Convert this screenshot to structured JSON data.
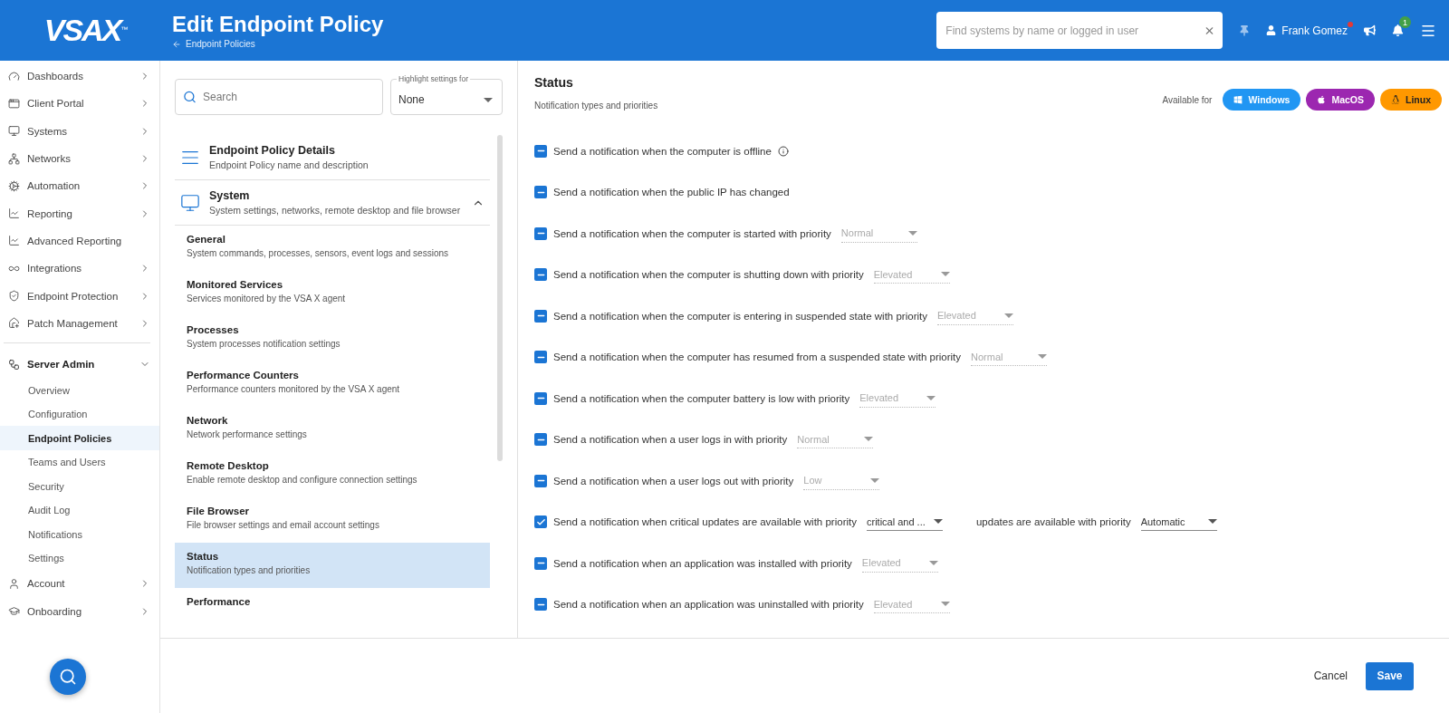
{
  "header": {
    "logo": "VSAX",
    "logo_mark": "™",
    "title": "Edit Endpoint Policy",
    "back_link": "Endpoint Policies",
    "search": {
      "placeholder": "Find systems by name or logged in user"
    },
    "user": "Frank Gomez",
    "notifications_badge": "1"
  },
  "sidebar": {
    "items": [
      {
        "label": "Dashboards",
        "expandable": true,
        "expanded": false
      },
      {
        "label": "Client Portal",
        "expandable": true,
        "expanded": false
      },
      {
        "label": "Systems",
        "expandable": true,
        "expanded": false
      },
      {
        "label": "Networks",
        "expandable": true,
        "expanded": false
      },
      {
        "label": "Automation",
        "expandable": true,
        "expanded": false
      },
      {
        "label": "Reporting",
        "expandable": true,
        "expanded": false
      },
      {
        "label": "Advanced Reporting",
        "expandable": false,
        "expanded": false
      },
      {
        "label": "Integrations",
        "expandable": true,
        "expanded": false
      },
      {
        "label": "Endpoint Protection",
        "expandable": true,
        "expanded": false
      },
      {
        "label": "Patch Management",
        "expandable": true,
        "expanded": false
      },
      {
        "label": "Server Admin",
        "expandable": true,
        "expanded": true,
        "children": [
          {
            "label": "Overview",
            "selected": false
          },
          {
            "label": "Configuration",
            "selected": false
          },
          {
            "label": "Endpoint Policies",
            "selected": true
          },
          {
            "label": "Teams and Users",
            "selected": false
          },
          {
            "label": "Security",
            "selected": false
          },
          {
            "label": "Audit Log",
            "selected": false
          },
          {
            "label": "Notifications",
            "selected": false
          },
          {
            "label": "Settings",
            "selected": false
          }
        ]
      },
      {
        "label": "Account",
        "expandable": true,
        "expanded": false
      },
      {
        "label": "Onboarding",
        "expandable": true,
        "expanded": false
      }
    ]
  },
  "settings_nav": {
    "search": {
      "placeholder": "Search"
    },
    "highlight": {
      "label": "Highlight settings for",
      "value": "None"
    },
    "sections": [
      {
        "title": "Endpoint Policy Details",
        "description": "Endpoint Policy name and description",
        "expandable": false
      },
      {
        "title": "System",
        "description": "System settings, networks, remote desktop and file browser",
        "expandable": true,
        "expanded": true,
        "children": [
          {
            "title": "General",
            "description": "System commands, processes, sensors, event logs and sessions",
            "selected": false
          },
          {
            "title": "Monitored Services",
            "description": "Services monitored by the VSA X agent",
            "selected": false
          },
          {
            "title": "Processes",
            "description": "System processes notification settings",
            "selected": false
          },
          {
            "title": "Performance Counters",
            "description": "Performance counters monitored by the VSA X agent",
            "selected": false
          },
          {
            "title": "Network",
            "description": "Network performance settings",
            "selected": false
          },
          {
            "title": "Remote Desktop",
            "description": "Enable remote desktop and configure connection settings",
            "selected": false
          },
          {
            "title": "File Browser",
            "description": "File browser settings and email account settings",
            "selected": false
          },
          {
            "title": "Status",
            "description": "Notification types and priorities",
            "selected": true
          },
          {
            "title": "Performance",
            "selected": false
          }
        ]
      }
    ]
  },
  "status": {
    "title": "Status",
    "subtitle": "Notification types and priorities",
    "available_label": "Available for",
    "platforms": [
      {
        "label": "Windows",
        "color": "#2196f3"
      },
      {
        "label": "MacOS",
        "color": "#9c27b0"
      },
      {
        "label": "Linux",
        "color": "#ff9800"
      }
    ],
    "options": [
      {
        "checked": true,
        "indeterminate": true,
        "label": "Send a notification when the computer is offline",
        "info": true
      },
      {
        "checked": true,
        "indeterminate": true,
        "label": "Send a notification when the public IP has changed",
        "info": false
      },
      {
        "checked": true,
        "indeterminate": true,
        "label": "Send a notification when the computer is started with priority",
        "info": false,
        "priority": {
          "value": "Normal",
          "disabled": true
        }
      },
      {
        "checked": true,
        "indeterminate": true,
        "label": "Send a notification when the computer is shutting down with priority",
        "info": false,
        "priority": {
          "value": "Elevated",
          "disabled": true
        }
      },
      {
        "checked": true,
        "indeterminate": true,
        "label": "Send a notification when the computer is entering in suspended state with priority",
        "info": false,
        "priority": {
          "value": "Elevated",
          "disabled": true
        }
      },
      {
        "checked": true,
        "indeterminate": true,
        "label": "Send a notification when the computer has resumed from a suspended state with priority",
        "info": false,
        "priority": {
          "value": "Normal",
          "disabled": true
        }
      },
      {
        "checked": true,
        "indeterminate": true,
        "label": "Send a notification when the computer battery is low with priority",
        "info": false,
        "priority": {
          "value": "Elevated",
          "disabled": true
        }
      },
      {
        "checked": true,
        "indeterminate": true,
        "label": "Send a notification when a user logs in with priority",
        "info": false,
        "priority": {
          "value": "Normal",
          "disabled": true
        }
      },
      {
        "checked": true,
        "indeterminate": true,
        "label": "Send a notification when a user logs out with priority",
        "info": false,
        "priority": {
          "value": "Low",
          "disabled": true
        }
      },
      {
        "checked": true,
        "indeterminate": false,
        "label": "Send a notification when critical updates are available with priority",
        "info": false,
        "priority": {
          "value": "critical and ...",
          "disabled": false
        },
        "tail": "updates are available with priority",
        "tail_priority": {
          "value": "Automatic",
          "disabled": false
        }
      },
      {
        "checked": true,
        "indeterminate": true,
        "label": "Send a notification when an application was installed with priority",
        "info": false,
        "priority": {
          "value": "Elevated",
          "disabled": true
        }
      },
      {
        "checked": true,
        "indeterminate": true,
        "label": "Send a notification when an application was uninstalled with priority",
        "info": false,
        "priority": {
          "value": "Elevated",
          "disabled": true
        }
      }
    ]
  },
  "footer": {
    "cancel": "Cancel",
    "save": "Save"
  }
}
